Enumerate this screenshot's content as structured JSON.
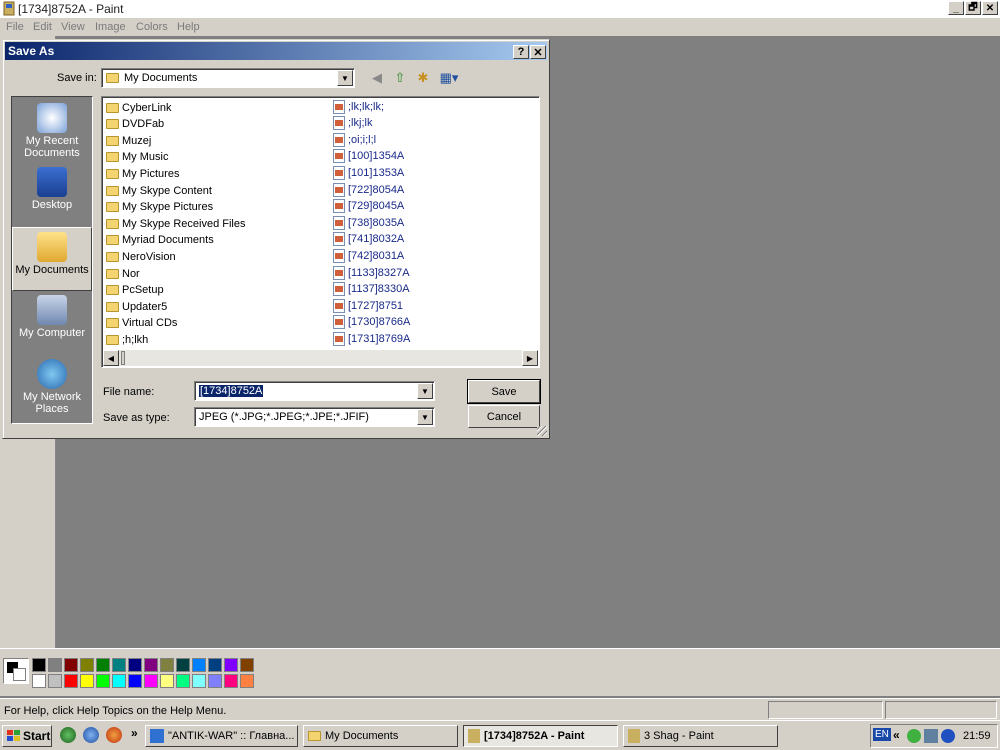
{
  "window": {
    "title": "[1734]8752A - Paint",
    "controls": [
      "_",
      "🗗",
      "✕"
    ]
  },
  "menu": [
    "File",
    "Edit",
    "View",
    "Image",
    "Colors",
    "Help"
  ],
  "dialog": {
    "title": "Save As",
    "help_btn": "?",
    "close_btn": "✕",
    "save_in_label": "Save in:",
    "save_in_value": "My Documents",
    "places": [
      {
        "label": "My Recent Documents",
        "icon": "recent-documents-icon"
      },
      {
        "label": "Desktop",
        "icon": "desktop-icon"
      },
      {
        "label": "My Documents",
        "icon": "my-documents-icon"
      },
      {
        "label": "My Computer",
        "icon": "my-computer-icon"
      },
      {
        "label": "My Network Places",
        "icon": "network-places-icon"
      }
    ],
    "files_col1": [
      "CyberLink",
      "DVDFab",
      "Muzej",
      "My Music",
      "My Pictures",
      "My Skype Content",
      "My Skype Pictures",
      "My Skype Received Files",
      "Myriad Documents",
      "NeroVision",
      "Nor",
      "PcSetup",
      "Updater5",
      "Virtual CDs",
      ";h;lkh"
    ],
    "files_col2": [
      ";lk;lk;lk;",
      ";lkj;lk",
      ";oi;i;l;l",
      "[100]1354A",
      "[101]1353A",
      "[722]8054A",
      "[729]8045A",
      "[738]8035A",
      "[741]8032A",
      "[742]8031A",
      "[1133]8327A",
      "[1137]8330A",
      "[1727]8751",
      "[1730]8766A",
      "[1731]8769A"
    ],
    "file_name_label": "File name:",
    "file_name_value": "[1734]8752A",
    "save_type_label": "Save as type:",
    "save_type_value": "JPEG (*.JPG;*.JPEG;*.JPE;*.JFIF)",
    "save_button": "Save",
    "cancel_button": "Cancel"
  },
  "palette": {
    "top": [
      "#000000",
      "#808080",
      "#800000",
      "#808000",
      "#008000",
      "#008080",
      "#000080",
      "#800080",
      "#808040",
      "#004040",
      "#0080ff",
      "#004080",
      "#8000ff",
      "#804000"
    ],
    "bottom": [
      "#ffffff",
      "#c0c0c0",
      "#ff0000",
      "#ffff00",
      "#00ff00",
      "#00ffff",
      "#0000ff",
      "#ff00ff",
      "#ffff80",
      "#00ff80",
      "#80ffff",
      "#8080ff",
      "#ff0080",
      "#ff8040"
    ]
  },
  "status": {
    "help_text": "For Help, click Help Topics on the Help Menu."
  },
  "taskbar": {
    "start": "Start",
    "chevron": "»",
    "buttons": [
      {
        "label": "\"ANTIK-WAR\" :: Главна...",
        "active": false
      },
      {
        "label": "My Documents",
        "active": false
      },
      {
        "label": "[1734]8752A - Paint",
        "active": true
      },
      {
        "label": "3 Shag - Paint",
        "active": false
      }
    ],
    "lang": "EN",
    "tray_chevron": "«",
    "clock": "21:59"
  }
}
